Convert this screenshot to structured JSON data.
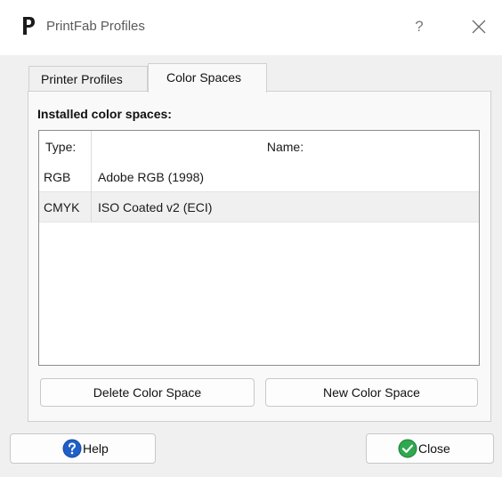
{
  "window": {
    "title": "PrintFab Profiles",
    "help_glyph": "?",
    "logo_icon": "printfab-logo-icon",
    "close_icon": "close-icon"
  },
  "tabs": [
    {
      "label": "Printer Profiles",
      "active": false
    },
    {
      "label": "Color Spaces",
      "active": true
    }
  ],
  "section": {
    "label": "Installed color spaces:"
  },
  "table": {
    "columns": [
      "Type:",
      "Name:"
    ],
    "rows": [
      {
        "type": "RGB",
        "name": "Adobe RGB (1998)",
        "selected": false
      },
      {
        "type": "CMYK",
        "name": "ISO Coated v2 (ECI)",
        "selected": true
      }
    ]
  },
  "buttons": {
    "delete_label": "Delete Color Space",
    "new_label": "New Color Space",
    "help_label": "Help",
    "close_label": "Close",
    "help_icon": "question-circle-icon",
    "close_icon": "check-circle-icon"
  },
  "colors": {
    "help_icon_blue": "#1f5fc8",
    "close_icon_green": "#2fa84f",
    "selected_row": "#f0f0f0"
  }
}
